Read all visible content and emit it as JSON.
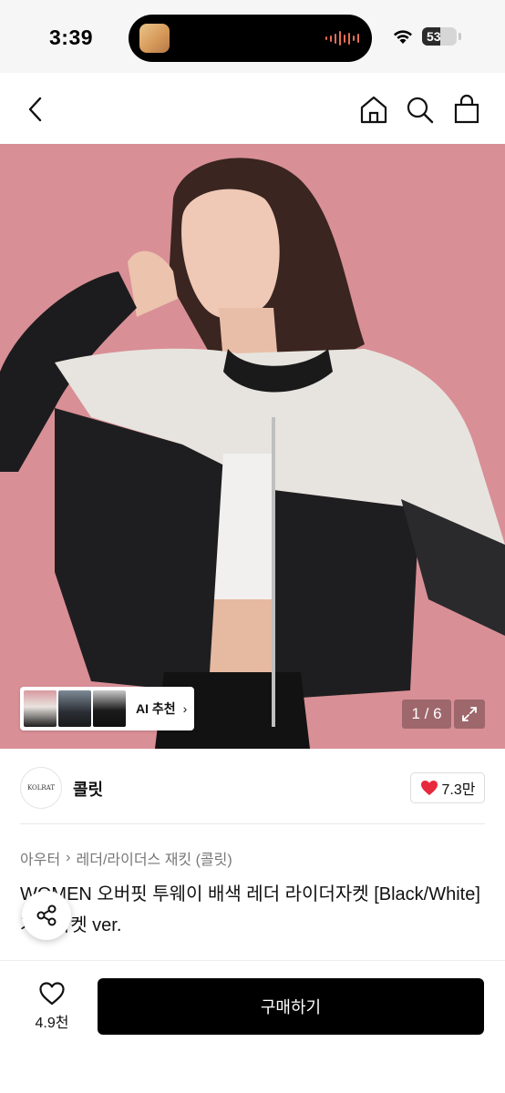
{
  "status_bar": {
    "time": "3:39",
    "battery": "53",
    "battery_level_percent": 53
  },
  "nav": {
    "back_icon": "chevron-left-icon",
    "icons": [
      "home-icon",
      "search-icon",
      "shopping-bag-icon"
    ]
  },
  "hero": {
    "ai_chip_label": "AI 추천",
    "pager": "1 / 6",
    "background_color": "#d98f96"
  },
  "seller": {
    "logo_text": "KOLRAT",
    "name": "콜릿",
    "like_count": "7.3만"
  },
  "product": {
    "breadcrumb": [
      "아우터",
      "레더/라이더스 재킷 (콜릿)"
    ],
    "title": "WOMEN 오버핏 투웨이 배색 레더 라이더자켓 [Black/White] 가죽자켓 ver."
  },
  "bottom": {
    "wish_count": "4.9천",
    "buy_label": "구매하기"
  },
  "colors": {
    "buy_button": "#000000",
    "heart": "#e8283c",
    "accent_text": "#111111"
  }
}
